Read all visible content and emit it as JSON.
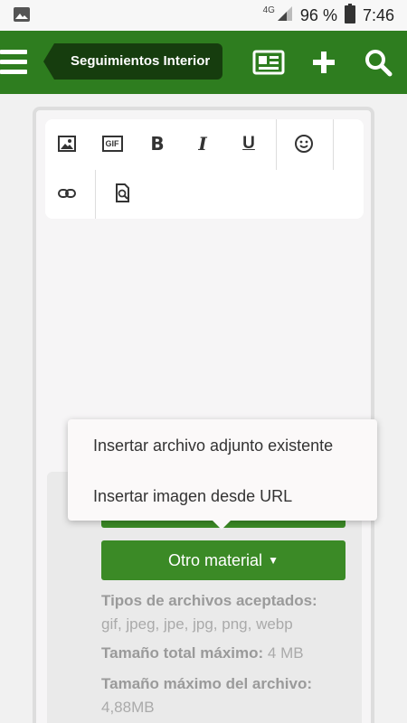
{
  "status_bar": {
    "network": "4G",
    "battery": "96 %",
    "time": "7:46"
  },
  "header": {
    "breadcrumb": "Seguimientos Interior",
    "icons": [
      "menu-icon",
      "newspaper-icon",
      "plus-icon",
      "search-icon"
    ]
  },
  "toolbar": {
    "buttons": [
      "image-icon",
      "gif-icon",
      "bold-icon",
      "italic-icon",
      "underline-icon",
      "smiley-icon",
      "link-icon",
      "preview-icon"
    ],
    "gif_label": "GIF",
    "bold_label": "B",
    "italic_label": "I",
    "underline_label": "U"
  },
  "popup_menu": {
    "items": [
      "Insertar archivo adjunto existente",
      "Insertar imagen desde URL"
    ]
  },
  "upload": {
    "other_button": "Otro material",
    "accepted_label": "Tipos de archivos aceptados:",
    "accepted_value": "gif, jpeg, jpe, jpg, png, webp",
    "total_label": "Tamaño total máximo:",
    "total_value": "4 MB",
    "file_label": "Tamaño máximo del archivo:",
    "file_value": "4,88MB"
  },
  "colors": {
    "header_green": "#2e7d1f",
    "breadcrumb_dark": "#163d0e",
    "button_green": "#3b8a26"
  }
}
